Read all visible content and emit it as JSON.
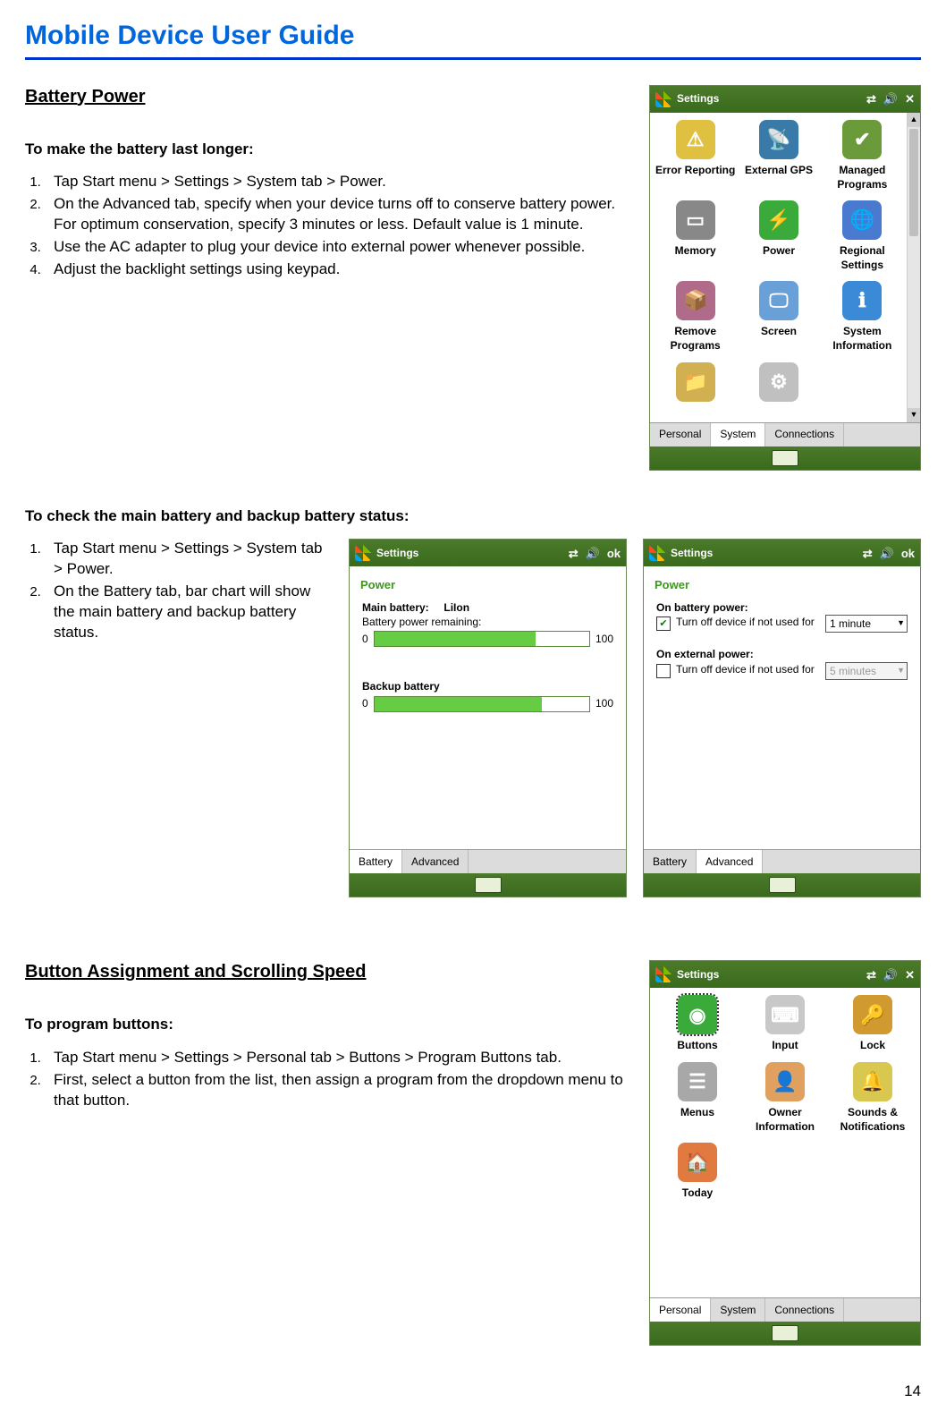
{
  "doc_title": "Mobile Device User Guide",
  "page_number": "14",
  "section1": {
    "heading": "Battery Power",
    "sub1": "To make the battery last longer:",
    "steps1": [
      "Tap Start menu > Settings > System tab > Power.",
      "On the Advanced tab, specify when your device turns off to conserve battery power. For optimum conservation, specify 3 minutes or less. Default value is 1 minute.",
      "Use the AC adapter to plug your device into external power whenever possible.",
      "Adjust the backlight settings using keypad."
    ],
    "sub2": "To check the main battery and backup battery status:",
    "steps2": [
      "Tap Start menu > Settings > System tab > Power.",
      "On the Battery tab, bar chart will show the main battery and backup battery status."
    ]
  },
  "section2": {
    "heading": "Button Assignment and Scrolling Speed",
    "sub1": "To program buttons:",
    "steps1": [
      "Tap Start menu > Settings > Personal tab > Buttons > Program Buttons tab.",
      "First, select a button from the list, then assign a program from the dropdown menu to that button."
    ]
  },
  "shot_settings_system": {
    "title": "Settings",
    "close_glyph": "✕",
    "icons": [
      {
        "label": "Error Reporting",
        "color": "#e0c040",
        "glyph": "⚠"
      },
      {
        "label": "External GPS",
        "color": "#3a7aa8",
        "glyph": "📡"
      },
      {
        "label": "Managed Programs",
        "color": "#6a9a3a",
        "glyph": "✔"
      },
      {
        "label": "Memory",
        "color": "#888",
        "glyph": "▭"
      },
      {
        "label": "Power",
        "color": "#3aaa3a",
        "glyph": "⚡"
      },
      {
        "label": "Regional Settings",
        "color": "#4a7ad0",
        "glyph": "🌐"
      },
      {
        "label": "Remove Programs",
        "color": "#b06a8a",
        "glyph": "📦"
      },
      {
        "label": "Screen",
        "color": "#6aa0d8",
        "glyph": "🖵"
      },
      {
        "label": "System Information",
        "color": "#3a8ad8",
        "glyph": "ℹ"
      }
    ],
    "partial_row": [
      {
        "label": "",
        "color": "#d0b050",
        "glyph": "📁"
      },
      {
        "label": "",
        "color": "#c0c0c0",
        "glyph": "⚙"
      }
    ],
    "tabs": [
      "Personal",
      "System",
      "Connections"
    ],
    "active_tab": 1
  },
  "shot_power_battery": {
    "title": "Settings",
    "ok_label": "ok",
    "panel_label": "Power",
    "main_label": "Main battery:",
    "main_type": "LiIon",
    "remaining_label": "Battery power remaining:",
    "scale_min": "0",
    "scale_max": "100",
    "main_pct": 75,
    "backup_label": "Backup battery",
    "backup_pct": 78,
    "tabs": [
      "Battery",
      "Advanced"
    ],
    "active_tab": 0
  },
  "shot_power_advanced": {
    "title": "Settings",
    "ok_label": "ok",
    "panel_label": "Power",
    "batt_heading": "On battery power:",
    "batt_check_label": "Turn off device if not used for",
    "batt_checked": true,
    "batt_value": "1 minute",
    "ext_heading": "On external power:",
    "ext_check_label": "Turn off device if not used for",
    "ext_checked": false,
    "ext_value": "5 minutes",
    "tabs": [
      "Battery",
      "Advanced"
    ],
    "active_tab": 1
  },
  "shot_settings_personal": {
    "title": "Settings",
    "close_glyph": "✕",
    "icons": [
      {
        "label": "Buttons",
        "color": "#3aaa3a",
        "glyph": "◉",
        "active": true
      },
      {
        "label": "Input",
        "color": "#c8c8c8",
        "glyph": "⌨"
      },
      {
        "label": "Lock",
        "color": "#d09a30",
        "glyph": "🔑"
      },
      {
        "label": "Menus",
        "color": "#a8a8a8",
        "glyph": "☰"
      },
      {
        "label": "Owner Information",
        "color": "#e0a060",
        "glyph": "👤"
      },
      {
        "label": "Sounds & Notifications",
        "color": "#d8c850",
        "glyph": "🔔"
      },
      {
        "label": "Today",
        "color": "#e07a40",
        "glyph": "🏠"
      }
    ],
    "tabs": [
      "Personal",
      "System",
      "Connections"
    ],
    "active_tab": 0
  }
}
